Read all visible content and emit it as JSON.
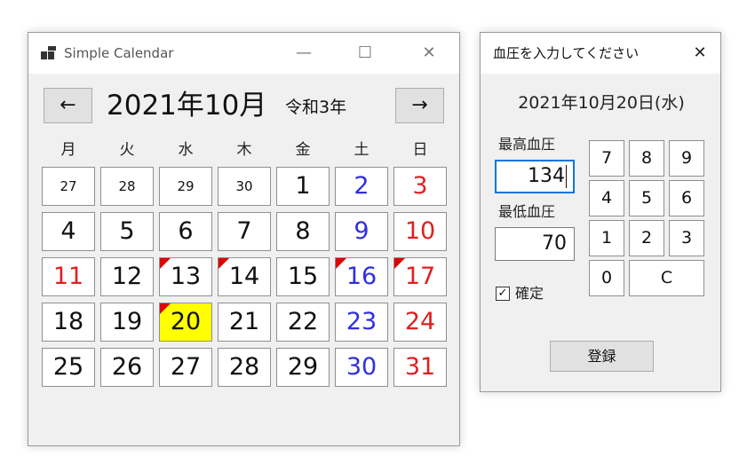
{
  "calendar_window": {
    "title": "Simple Calendar",
    "minimize_glyph": "—",
    "maximize_glyph": "☐",
    "close_glyph": "✕",
    "prev_label": "←",
    "next_label": "→",
    "month_title": "2021年10月",
    "era_label": "令和3年",
    "weekdays": [
      "月",
      "火",
      "水",
      "木",
      "金",
      "土",
      "日"
    ],
    "weeks": [
      [
        {
          "d": "27",
          "small": true
        },
        {
          "d": "28",
          "small": true
        },
        {
          "d": "29",
          "small": true
        },
        {
          "d": "30",
          "small": true
        },
        {
          "d": "1"
        },
        {
          "d": "2",
          "kind": "sat"
        },
        {
          "d": "3",
          "kind": "sun"
        }
      ],
      [
        {
          "d": "4"
        },
        {
          "d": "5"
        },
        {
          "d": "6"
        },
        {
          "d": "7"
        },
        {
          "d": "8"
        },
        {
          "d": "9",
          "kind": "sat"
        },
        {
          "d": "10",
          "kind": "sun"
        }
      ],
      [
        {
          "d": "11",
          "kind": "sun"
        },
        {
          "d": "12"
        },
        {
          "d": "13",
          "marked": true
        },
        {
          "d": "14",
          "marked": true
        },
        {
          "d": "15"
        },
        {
          "d": "16",
          "kind": "sat",
          "marked": true
        },
        {
          "d": "17",
          "kind": "sun",
          "marked": true
        }
      ],
      [
        {
          "d": "18"
        },
        {
          "d": "19"
        },
        {
          "d": "20",
          "marked": true,
          "today": true
        },
        {
          "d": "21"
        },
        {
          "d": "22"
        },
        {
          "d": "23",
          "kind": "sat"
        },
        {
          "d": "24",
          "kind": "sun"
        }
      ],
      [
        {
          "d": "25"
        },
        {
          "d": "26"
        },
        {
          "d": "27"
        },
        {
          "d": "28"
        },
        {
          "d": "29"
        },
        {
          "d": "30",
          "kind": "sat"
        },
        {
          "d": "31",
          "kind": "sun"
        }
      ]
    ]
  },
  "bp_window": {
    "title": "血圧を入力してください",
    "close_glyph": "✕",
    "date_heading": "2021年10月20日(水)",
    "systolic_label": "最高血圧",
    "systolic_value": "134",
    "diastolic_label": "最低血圧",
    "diastolic_value": "70",
    "keys": {
      "k7": "7",
      "k8": "8",
      "k9": "9",
      "k4": "4",
      "k5": "5",
      "k6": "6",
      "k1": "1",
      "k2": "2",
      "k3": "3",
      "k0": "0",
      "kc": "C"
    },
    "confirm_label": "確定",
    "confirm_checked": true,
    "check_glyph": "✓",
    "register_label": "登録"
  },
  "colors": {
    "saturday": "#2f2fe0",
    "sunday": "#e02020",
    "today": "#ffff00",
    "mark": "#e00000",
    "focus": "#0078d7"
  }
}
